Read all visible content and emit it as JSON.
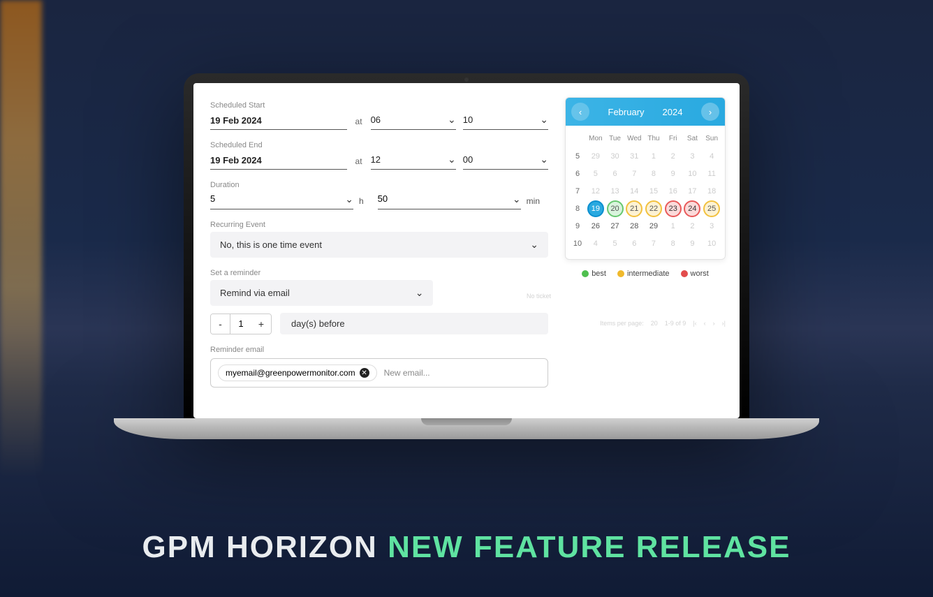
{
  "form": {
    "scheduledStartLabel": "Scheduled Start",
    "scheduledStartDate": "19 Feb 2024",
    "at": "at",
    "startHour": "06",
    "startMin": "10",
    "scheduledEndLabel": "Scheduled End",
    "scheduledEndDate": "19 Feb 2024",
    "endHour": "12",
    "endMin": "00",
    "durationLabel": "Duration",
    "durationHours": "5",
    "durationHUnit": "h",
    "durationMins": "50",
    "durationMUnit": "min",
    "recurringLabel": "Recurring Event",
    "recurringValue": "No, this is one time event",
    "reminderLabel": "Set a reminder",
    "reminderValue": "Remind via email",
    "reminderDays": "1",
    "daysBefore": "day(s) before",
    "reminderEmailLabel": "Reminder email",
    "email": "myemail@greenpowermonitor.com",
    "newEmail": "New email..."
  },
  "calendar": {
    "prev": "‹",
    "next": "›",
    "month": "February",
    "year": "2024",
    "dow": [
      "Mon",
      "Tue",
      "Wed",
      "Thu",
      "Fri",
      "Sat",
      "Sun"
    ],
    "rows": [
      {
        "wk": "5",
        "days": [
          {
            "n": "29",
            "c": "muted"
          },
          {
            "n": "30",
            "c": "muted"
          },
          {
            "n": "31",
            "c": "muted"
          },
          {
            "n": "1",
            "c": "muted"
          },
          {
            "n": "2",
            "c": "muted"
          },
          {
            "n": "3",
            "c": "muted"
          },
          {
            "n": "4",
            "c": "muted"
          }
        ]
      },
      {
        "wk": "6",
        "days": [
          {
            "n": "5",
            "c": "muted"
          },
          {
            "n": "6",
            "c": "muted"
          },
          {
            "n": "7",
            "c": "muted"
          },
          {
            "n": "8",
            "c": "muted"
          },
          {
            "n": "9",
            "c": "muted"
          },
          {
            "n": "10",
            "c": "muted"
          },
          {
            "n": "11",
            "c": "muted"
          }
        ]
      },
      {
        "wk": "7",
        "days": [
          {
            "n": "12",
            "c": "muted"
          },
          {
            "n": "13",
            "c": "muted"
          },
          {
            "n": "14",
            "c": "muted"
          },
          {
            "n": "15",
            "c": "muted"
          },
          {
            "n": "16",
            "c": "muted"
          },
          {
            "n": "17",
            "c": "muted"
          },
          {
            "n": "18",
            "c": "muted"
          }
        ]
      },
      {
        "wk": "8",
        "days": [
          {
            "n": "19",
            "c": "sel-day"
          },
          {
            "n": "20",
            "c": "ring ring-green"
          },
          {
            "n": "21",
            "c": "ring ring-yellow"
          },
          {
            "n": "22",
            "c": "ring ring-yellow"
          },
          {
            "n": "23",
            "c": "ring ring-red"
          },
          {
            "n": "24",
            "c": "ring ring-red"
          },
          {
            "n": "25",
            "c": "ring ring-yellow"
          }
        ]
      },
      {
        "wk": "9",
        "days": [
          {
            "n": "26",
            "c": ""
          },
          {
            "n": "27",
            "c": ""
          },
          {
            "n": "28",
            "c": ""
          },
          {
            "n": "29",
            "c": ""
          },
          {
            "n": "1",
            "c": "muted"
          },
          {
            "n": "2",
            "c": "muted"
          },
          {
            "n": "3",
            "c": "muted"
          }
        ]
      },
      {
        "wk": "10",
        "days": [
          {
            "n": "4",
            "c": "muted"
          },
          {
            "n": "5",
            "c": "muted"
          },
          {
            "n": "6",
            "c": "muted"
          },
          {
            "n": "7",
            "c": "muted"
          },
          {
            "n": "8",
            "c": "muted"
          },
          {
            "n": "9",
            "c": "muted"
          },
          {
            "n": "10",
            "c": "muted"
          }
        ]
      }
    ],
    "legend": {
      "best": "best",
      "intermediate": "intermediate",
      "worst": "worst"
    }
  },
  "pager": {
    "itemsPerPageLabel": "Items per page:",
    "itemsPerPage": "20",
    "range": "1-9 of 9",
    "noTicket": "No ticket"
  },
  "banner": {
    "left": "GPM HORIZON ",
    "right": "NEW FEATURE RELEASE"
  }
}
